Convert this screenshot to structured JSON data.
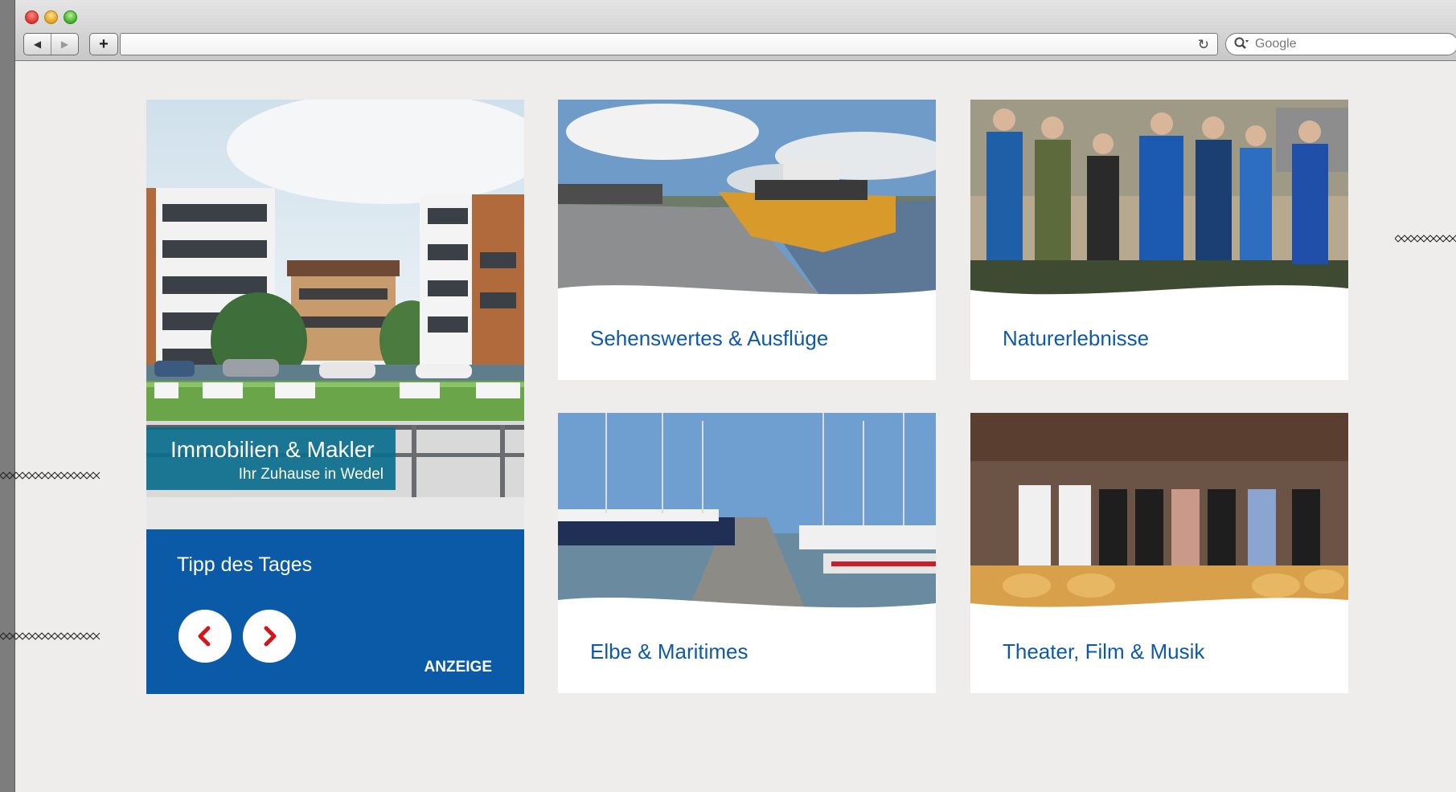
{
  "browser": {
    "search_placeholder": "Google",
    "back_glyph": "◀",
    "forward_glyph": "▶",
    "add_glyph": "+",
    "reload_glyph": "↻",
    "search_glyph": "🔍"
  },
  "feature": {
    "badge_title": "Immobilien & Makler",
    "badge_subtitle": "Ihr Zuhause in Wedel",
    "tipp_title": "Tipp des Tages",
    "anzeige": "ANZEIGE"
  },
  "tiles": [
    {
      "label": "Sehenswertes & Ausflüge"
    },
    {
      "label": "Naturerlebnisse"
    },
    {
      "label": "Elbe & Maritimes"
    },
    {
      "label": "Theater, Film & Musik"
    }
  ],
  "colors": {
    "accent_blue": "#0a5aa8",
    "label_blue": "#0e5aa7",
    "arrow_red": "#d4161c"
  }
}
